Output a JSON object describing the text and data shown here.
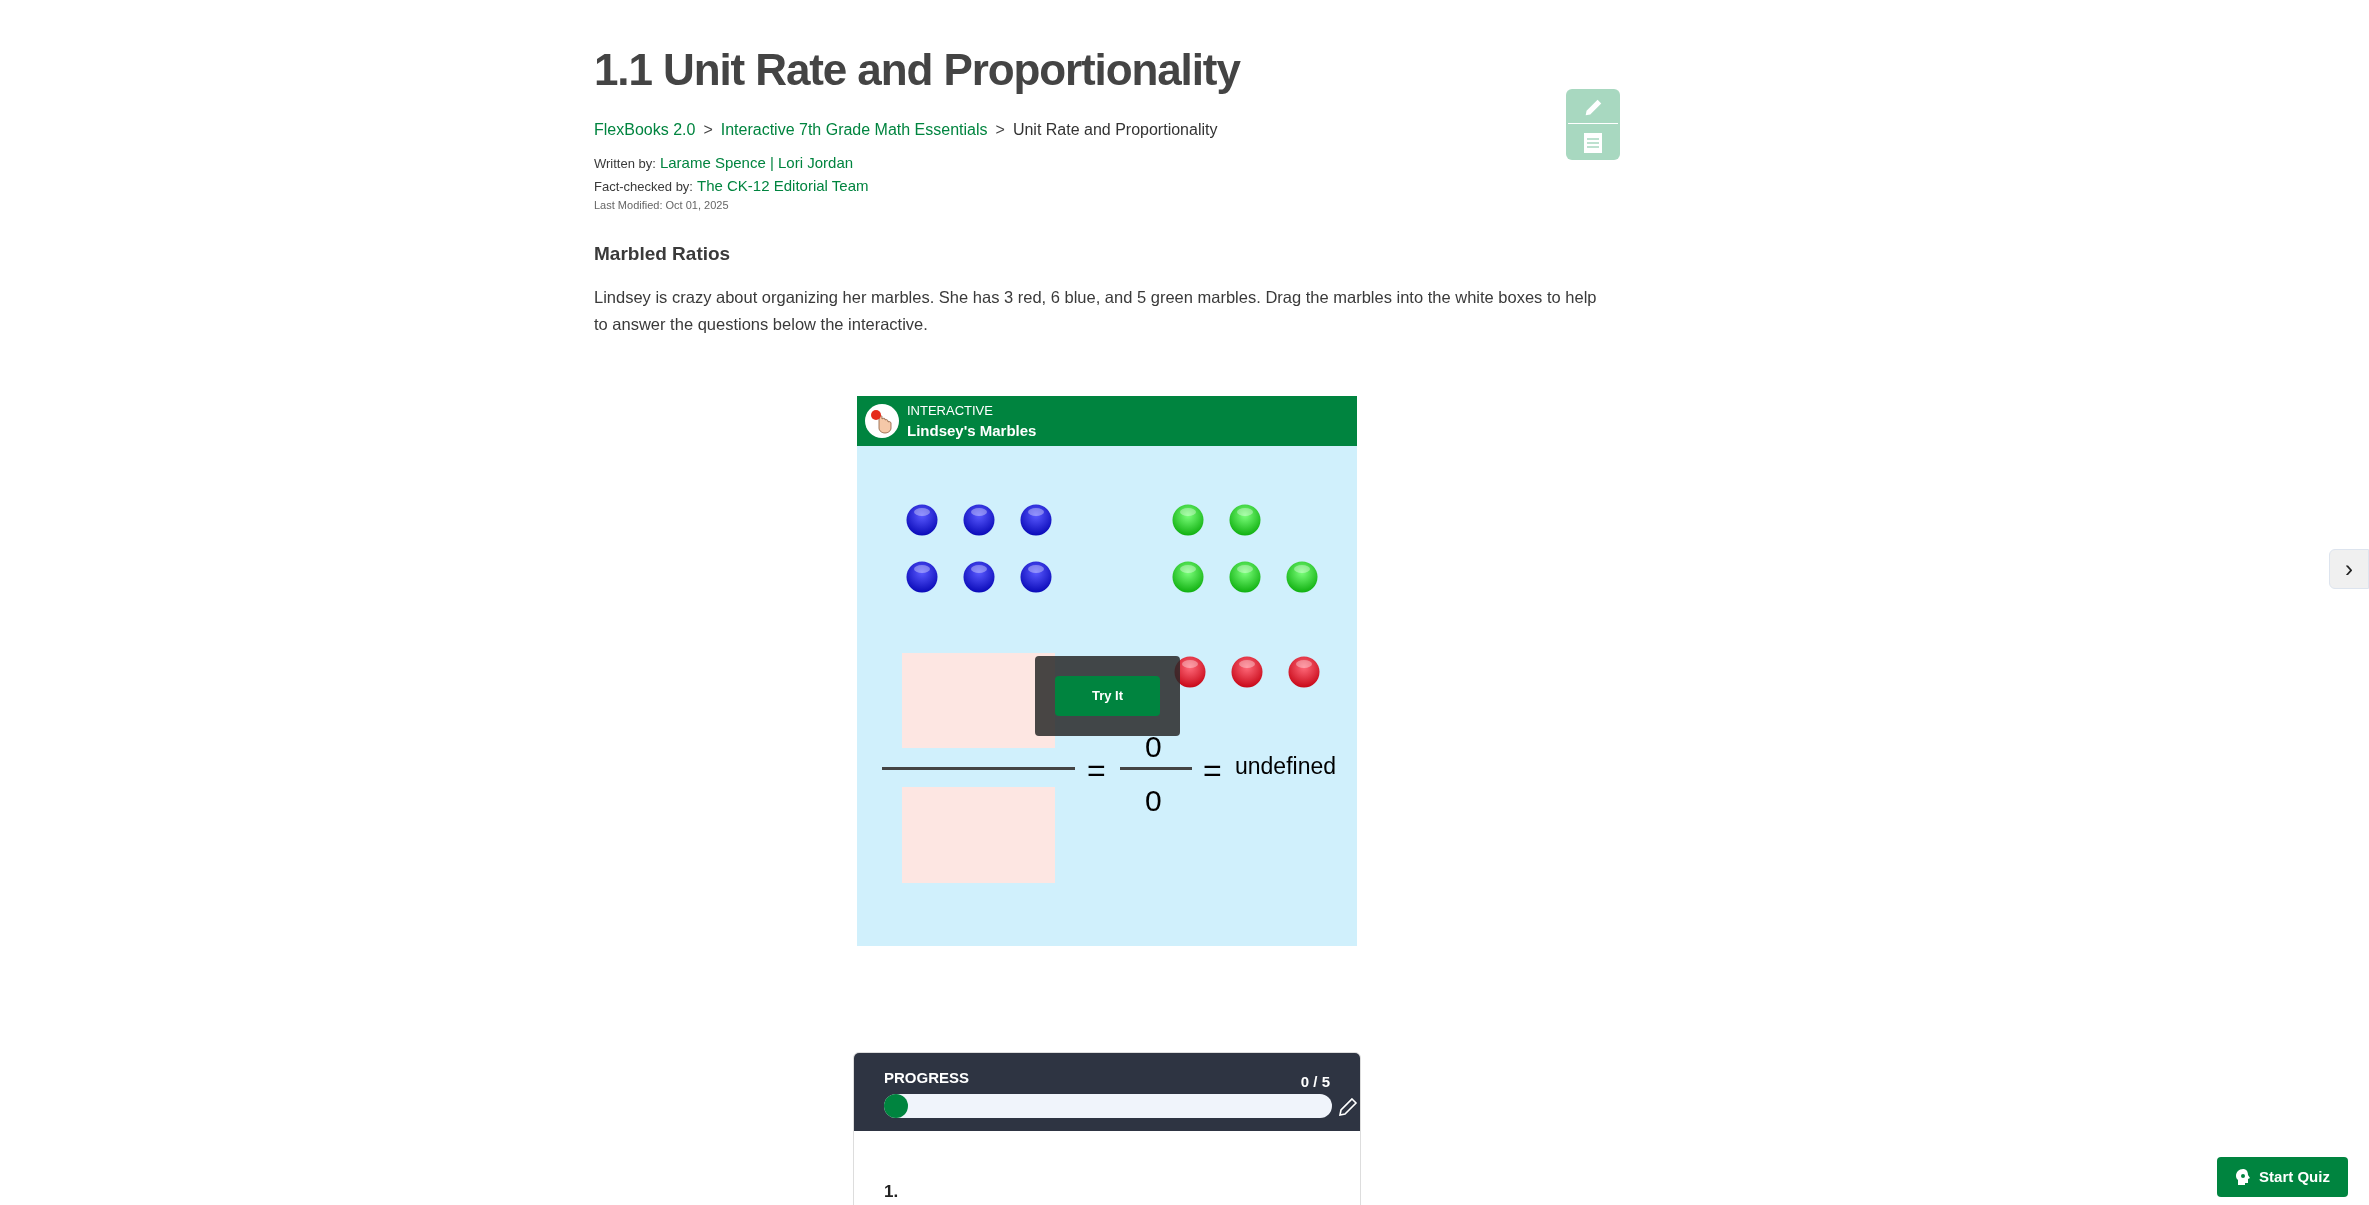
{
  "title": "1.1 Unit Rate and Proportionality",
  "breadcrumb": [
    {
      "label": "FlexBooks 2.0",
      "link": true
    },
    {
      "label": "Interactive 7th Grade Math Essentials",
      "link": true
    },
    {
      "label": "Unit Rate and Proportionality",
      "link": false
    }
  ],
  "breadcrumb_separator": ">",
  "written_by": {
    "label": "Written by:",
    "authors": "Larame Spence | Lori Jordan"
  },
  "fact_checked_by": {
    "label": "Fact-checked by:",
    "team": "The CK-12 Editorial Team"
  },
  "last_modified": "Last Modified: Oct 01, 2025",
  "section_heading": "Marbled Ratios",
  "intro": "Lindsey is crazy about organizing her marbles. She has 3 red, 6 blue, and 5 green marbles. Drag the marbles into the white boxes to help to answer the questions below the interactive.",
  "interactive": {
    "tag": "INTERACTIVE",
    "title": "Lindsey's Marbles",
    "equals": "=",
    "numerator": "0",
    "denominator": "0",
    "result": "undefined",
    "button": "Try It"
  },
  "progress": {
    "label": "PROGRESS",
    "count": "0 / 5",
    "level": 0
  },
  "question_number": "1.",
  "next_arrow": "›",
  "start_quiz": "Start Quiz"
}
